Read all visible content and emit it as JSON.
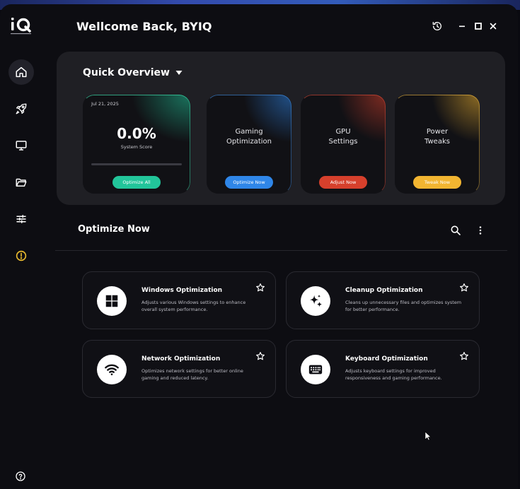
{
  "header": {
    "greeting": "Wellcome Back, BYIQ"
  },
  "sidebar": {
    "items": [
      {
        "icon": "home-icon",
        "active": true
      },
      {
        "icon": "rocket-icon",
        "active": false
      },
      {
        "icon": "monitor-icon",
        "active": false
      },
      {
        "icon": "folder-icon",
        "active": false
      },
      {
        "icon": "sliders-icon",
        "active": false
      },
      {
        "icon": "alert-icon",
        "active": false
      }
    ],
    "help_icon": "help-icon"
  },
  "overview": {
    "title": "Quick Overview",
    "score_card": {
      "date": "Jul 21, 2025",
      "value": "0.0%",
      "label": "System Score",
      "progress": 0.0,
      "button": "Optimize All",
      "accent": "#22c59a"
    },
    "cards": [
      {
        "line1": "Gaming",
        "line2": "Optimization",
        "button": "Optimize Now",
        "accent": "#2f86e8"
      },
      {
        "line1": "GPU",
        "line2": "Settings",
        "button": "Adjust Now",
        "accent": "#d6402c"
      },
      {
        "line1": "Power",
        "line2": "Tweaks",
        "button": "Tweak Now",
        "accent": "#f2b531"
      }
    ]
  },
  "optimize": {
    "title": "Optimize Now",
    "tiles": [
      {
        "title": "Windows Optimization",
        "desc": "Adjusts various Windows settings to enhance overall system performance.",
        "icon": "windows-icon"
      },
      {
        "title": "Cleanup Optimization",
        "desc": "Cleans up unnecessary files and optimizes system for better performance.",
        "icon": "sparkle-icon"
      },
      {
        "title": "Network Optimization",
        "desc": "Optimizes network settings for better online gaming and reduced latency.",
        "icon": "wifi-icon"
      },
      {
        "title": "Keyboard Optimization",
        "desc": "Adjusts keyboard settings for improved responsiveness and gaming performance.",
        "icon": "keyboard-icon"
      }
    ]
  },
  "colors": {
    "background": "#0d0d12",
    "panel": "#1f1f24",
    "alert": "#e8b92e"
  }
}
